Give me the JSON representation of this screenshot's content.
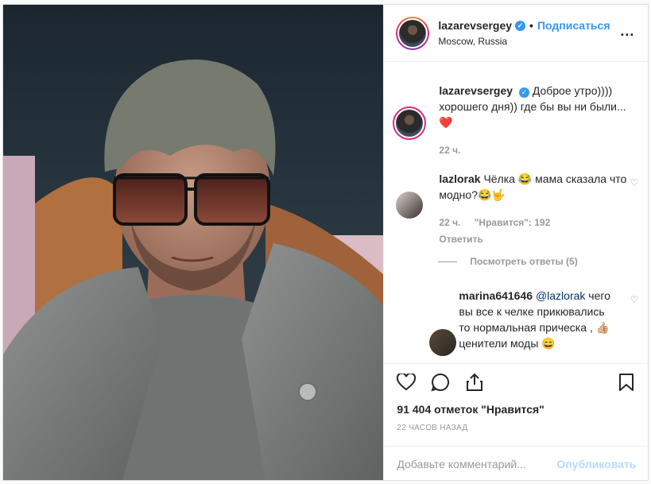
{
  "header": {
    "username": "lazarevsergey",
    "follow_label": "Подписаться",
    "location": "Moscow, Russia",
    "more_label": "..."
  },
  "caption": {
    "username": "lazarevsergey",
    "text": "Доброе утро)))) хорошего дня)) где бы вы ни были...",
    "emoji": "❤️",
    "time": "22 ч."
  },
  "comments": [
    {
      "username": "lazlorak",
      "text": "Чёлка 😂 мама сказала что модно?😂🤟",
      "time": "22 ч.",
      "likes": "\"Нравится\": 192",
      "reply_label": "Ответить"
    }
  ],
  "view_replies_label": "Посмотреть ответы (5)",
  "reply": {
    "username": "marina641646",
    "mention": "@lazlorak",
    "text": "чего вы все к челке прикювались то нормальная прическа , 👍🏼 ценители моды 😄"
  },
  "likes_count": "91 404 отметок \"Нравится\"",
  "posted_time": "22 ЧАСОВ НАЗАД",
  "comment_input": {
    "placeholder": "Добавьте комментарий...",
    "publish_label": "Опубликовать"
  },
  "colors": {
    "accent": "#3897f0",
    "publish_disabled": "#b3dbff",
    "muted": "#999999",
    "text": "#262626"
  },
  "icons": [
    "verified-icon",
    "more-icon",
    "heart-icon",
    "comment-icon",
    "share-icon",
    "bookmark-icon",
    "heart-small-icon"
  ]
}
